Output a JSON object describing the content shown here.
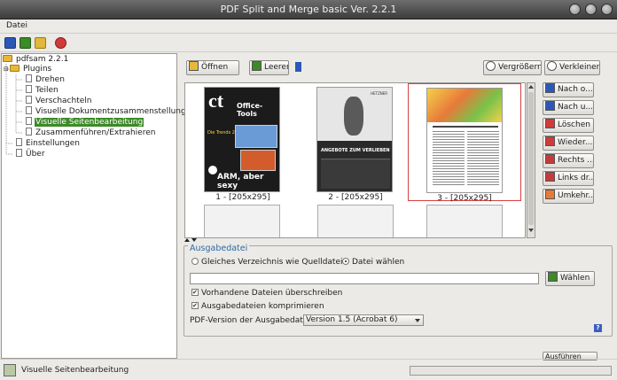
{
  "window": {
    "title": "PDF Split and Merge basic Ver. 2.2.1"
  },
  "menu": {
    "items": [
      {
        "label": "Datei"
      }
    ]
  },
  "toolbar": {
    "icons": [
      "save-icon",
      "load-icon",
      "clear-icon",
      "exit-icon"
    ]
  },
  "tree": {
    "items": [
      {
        "label": "pdfsam 2.2.1",
        "level": 0,
        "icon": "folder-icon"
      },
      {
        "label": "Plugins",
        "level": 1,
        "icon": "folder-icon"
      },
      {
        "label": "Drehen",
        "level": 2,
        "icon": "document-icon"
      },
      {
        "label": "Teilen",
        "level": 2,
        "icon": "document-icon"
      },
      {
        "label": "Verschachteln",
        "level": 2,
        "icon": "document-icon"
      },
      {
        "label": "Visuelle Dokumentzusammenstellung",
        "level": 2,
        "icon": "document-icon"
      },
      {
        "label": "Visuelle Seitenbearbeitung",
        "level": 2,
        "icon": "document-icon",
        "selected": true
      },
      {
        "label": "Zusammenführen/Extrahieren",
        "level": 2,
        "icon": "document-icon"
      },
      {
        "label": "Einstellungen",
        "level": 1,
        "icon": "document-icon"
      },
      {
        "label": "Über",
        "level": 1,
        "icon": "document-icon"
      }
    ]
  },
  "main": {
    "top_buttons": {
      "open": "Öffnen",
      "clear": "Leeren",
      "zoom_in": "Vergrößern",
      "zoom_out": "Verkleinern"
    },
    "thumbnails": [
      {
        "caption": "1 - [205x295]",
        "selected": false
      },
      {
        "caption": "2 - [205x295]",
        "selected": false
      },
      {
        "caption": "3 - [205x295]",
        "selected": true
      }
    ],
    "page1_text": {
      "masthead": "ct",
      "headline": "Office-Tools",
      "headline2": "Die Trends 2012",
      "headline3": "ARM, aber sexy"
    },
    "page2_text": {
      "brand": "HETZNER",
      "banner": "ANGEBOTE ZUM VERLIEBEN"
    },
    "side_buttons": [
      {
        "label": "Nach o...",
        "icon": "move-up-icon"
      },
      {
        "label": "Nach u...",
        "icon": "move-down-icon"
      },
      {
        "label": "Löschen",
        "icon": "delete-icon"
      },
      {
        "label": "Wieder...",
        "icon": "undelete-icon"
      },
      {
        "label": "Rechts ...",
        "icon": "rotate-right-icon"
      },
      {
        "label": "Links dr...",
        "icon": "rotate-left-icon"
      },
      {
        "label": "Umkehr...",
        "icon": "reverse-icon"
      }
    ],
    "output": {
      "title": "Ausgabedatei",
      "radio_same_dir": "Gleiches Verzeichnis wie Quelldatei",
      "radio_choose_file": "Datei wählen",
      "selected_radio": "radio_choose_file",
      "path_value": "",
      "choose_button": "Wählen",
      "overwrite_label": "Vorhandene Dateien überschreiben",
      "overwrite_checked": true,
      "compress_label": "Ausgabedateien komprimieren",
      "compress_checked": true,
      "pdf_version_label": "PDF-Version der Ausgabedatei:",
      "pdf_version_value": "Version 1.5 (Acrobat 6)",
      "help": "?"
    },
    "run_button": "Ausführen"
  },
  "status": {
    "text": "Visuelle Seitenbearbeitung",
    "progress": 0
  }
}
